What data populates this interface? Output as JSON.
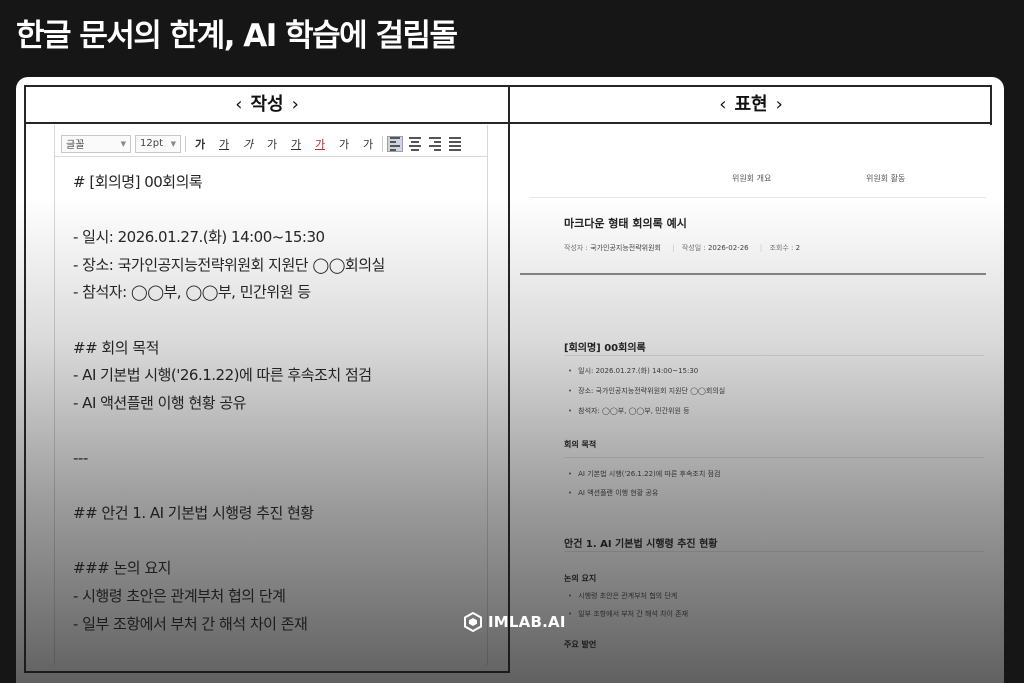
{
  "headline": "한글 문서의 한계, AI 학습에 걸림돌",
  "columns": {
    "left_header": "작성",
    "right_header": "표현",
    "chevron_left": "‹",
    "chevron_right": "›"
  },
  "editor": {
    "toolbar": {
      "font_family": "글꼴",
      "font_size": "12pt",
      "buttons": [
        "가",
        "가",
        "가",
        "가",
        "가",
        "가",
        "가",
        "가"
      ]
    },
    "lines": [
      "# [회의명] 00회의록",
      "",
      "- 일시: 2026.01.27.(화) 14:00~15:30",
      "- 장소: 국가인공지능전략위원회 지원단 ◯◯회의실",
      "- 참석자: ◯◯부, ◯◯부, 민간위원 등",
      "",
      "## 회의 목적",
      "- AI 기본법 시행('26.1.22)에 따른 후속조치 점검",
      "- AI 액션플랜 이행 현황 공유",
      "",
      "---",
      "",
      "## 안건 1. AI 기본법 시행령 추진 현황",
      "",
      "### 논의 요지",
      "- 시행령 초안은 관계부처 협의 단계",
      "- 일부 조항에서 부처 간 해석 차이 존재"
    ]
  },
  "preview": {
    "nav": [
      "위원회 개요",
      "위원회 활동"
    ],
    "title": "마크다운 형태 회의록 예시",
    "meta": {
      "author_label": "작성자 :",
      "author": "국가인공지능전략위원회",
      "date_label": "작성일 :",
      "date": "2026-02-26",
      "views_label": "조회수 :",
      "views": "2"
    },
    "h_minutes": "[회의명] 00회의록",
    "minutes_items": [
      "일시: 2026.01.27.(화) 14:00~15:30",
      "장소: 국가인공지능전략위원회 지원단 ◯◯회의실",
      "참석자: ◯◯부, ◯◯부, 민간위원 등"
    ],
    "h_purpose": "회의 목적",
    "purpose_items": [
      "AI 기본법 시행('26.1.22)에 따른 후속조치 점검",
      "AI 액션플랜 이행 현황 공유"
    ],
    "h_agenda1": "안건 1. AI 기본법 시행령 추진 현황",
    "h_summary": "논의 요지",
    "summary_items": [
      "시행령 초안은 관계부처 협의 단계",
      "일부 조항에서 부처 간 해석 차이 존재"
    ],
    "h_next": "주요 발언"
  },
  "watermark": "IMLAB.AI"
}
